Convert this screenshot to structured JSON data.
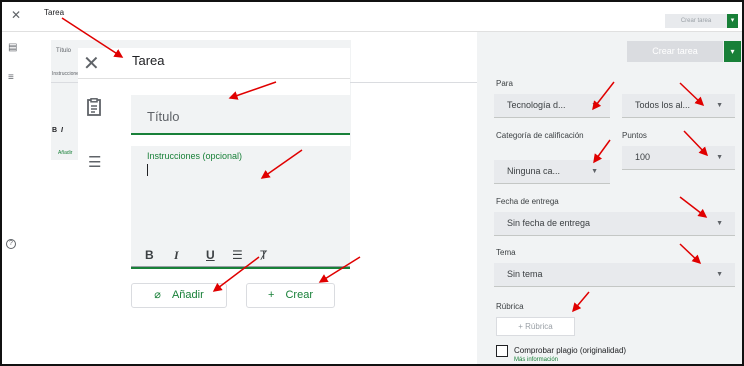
{
  "background": {
    "close_glyph": "✕",
    "title": "Tarea",
    "create_button": "Crear tarea",
    "left_icons": [
      "clipboard-icon",
      "menu-icon"
    ],
    "title_hint": "Título",
    "instructions_hint": "Instrucciones",
    "add_hint": "Añadir"
  },
  "panel": {
    "close_glyph": "✕",
    "title": "Tarea",
    "title_placeholder": "Título",
    "instructions_placeholder": "Instrucciones (opcional)",
    "format": {
      "bold": "B",
      "italic": "I",
      "underline": "U",
      "list": "☰",
      "clear": "Ⱦ"
    },
    "add_button": "Añadir",
    "create_button": "Crear"
  },
  "sidebar": {
    "create_button": "Crear tarea",
    "for_label": "Para",
    "class_value": "Tecnología d...",
    "students_value": "Todos los al...",
    "category_label": "Categoría de calificación",
    "category_value": "Ninguna ca...",
    "points_label": "Puntos",
    "points_value": "100",
    "due_label": "Fecha de entrega",
    "due_value": "Sin fecha de entrega",
    "topic_label": "Tema",
    "topic_value": "Sin tema",
    "rubric_label": "Rúbrica",
    "rubric_button": "Rúbrica",
    "plagiarism_label": "Comprobar plagio (originalidad)",
    "more_info": "Más información"
  },
  "icons": {
    "close": "close-icon",
    "clipboard": "clipboard-icon",
    "text": "text-icon",
    "attach": "attachment-icon",
    "plus": "plus-icon",
    "dropdown": "dropdown-arrow-icon",
    "help": "help-icon"
  },
  "colors": {
    "accent": "#188038",
    "annotation": "#e00000",
    "field": "#f1f3f4"
  }
}
